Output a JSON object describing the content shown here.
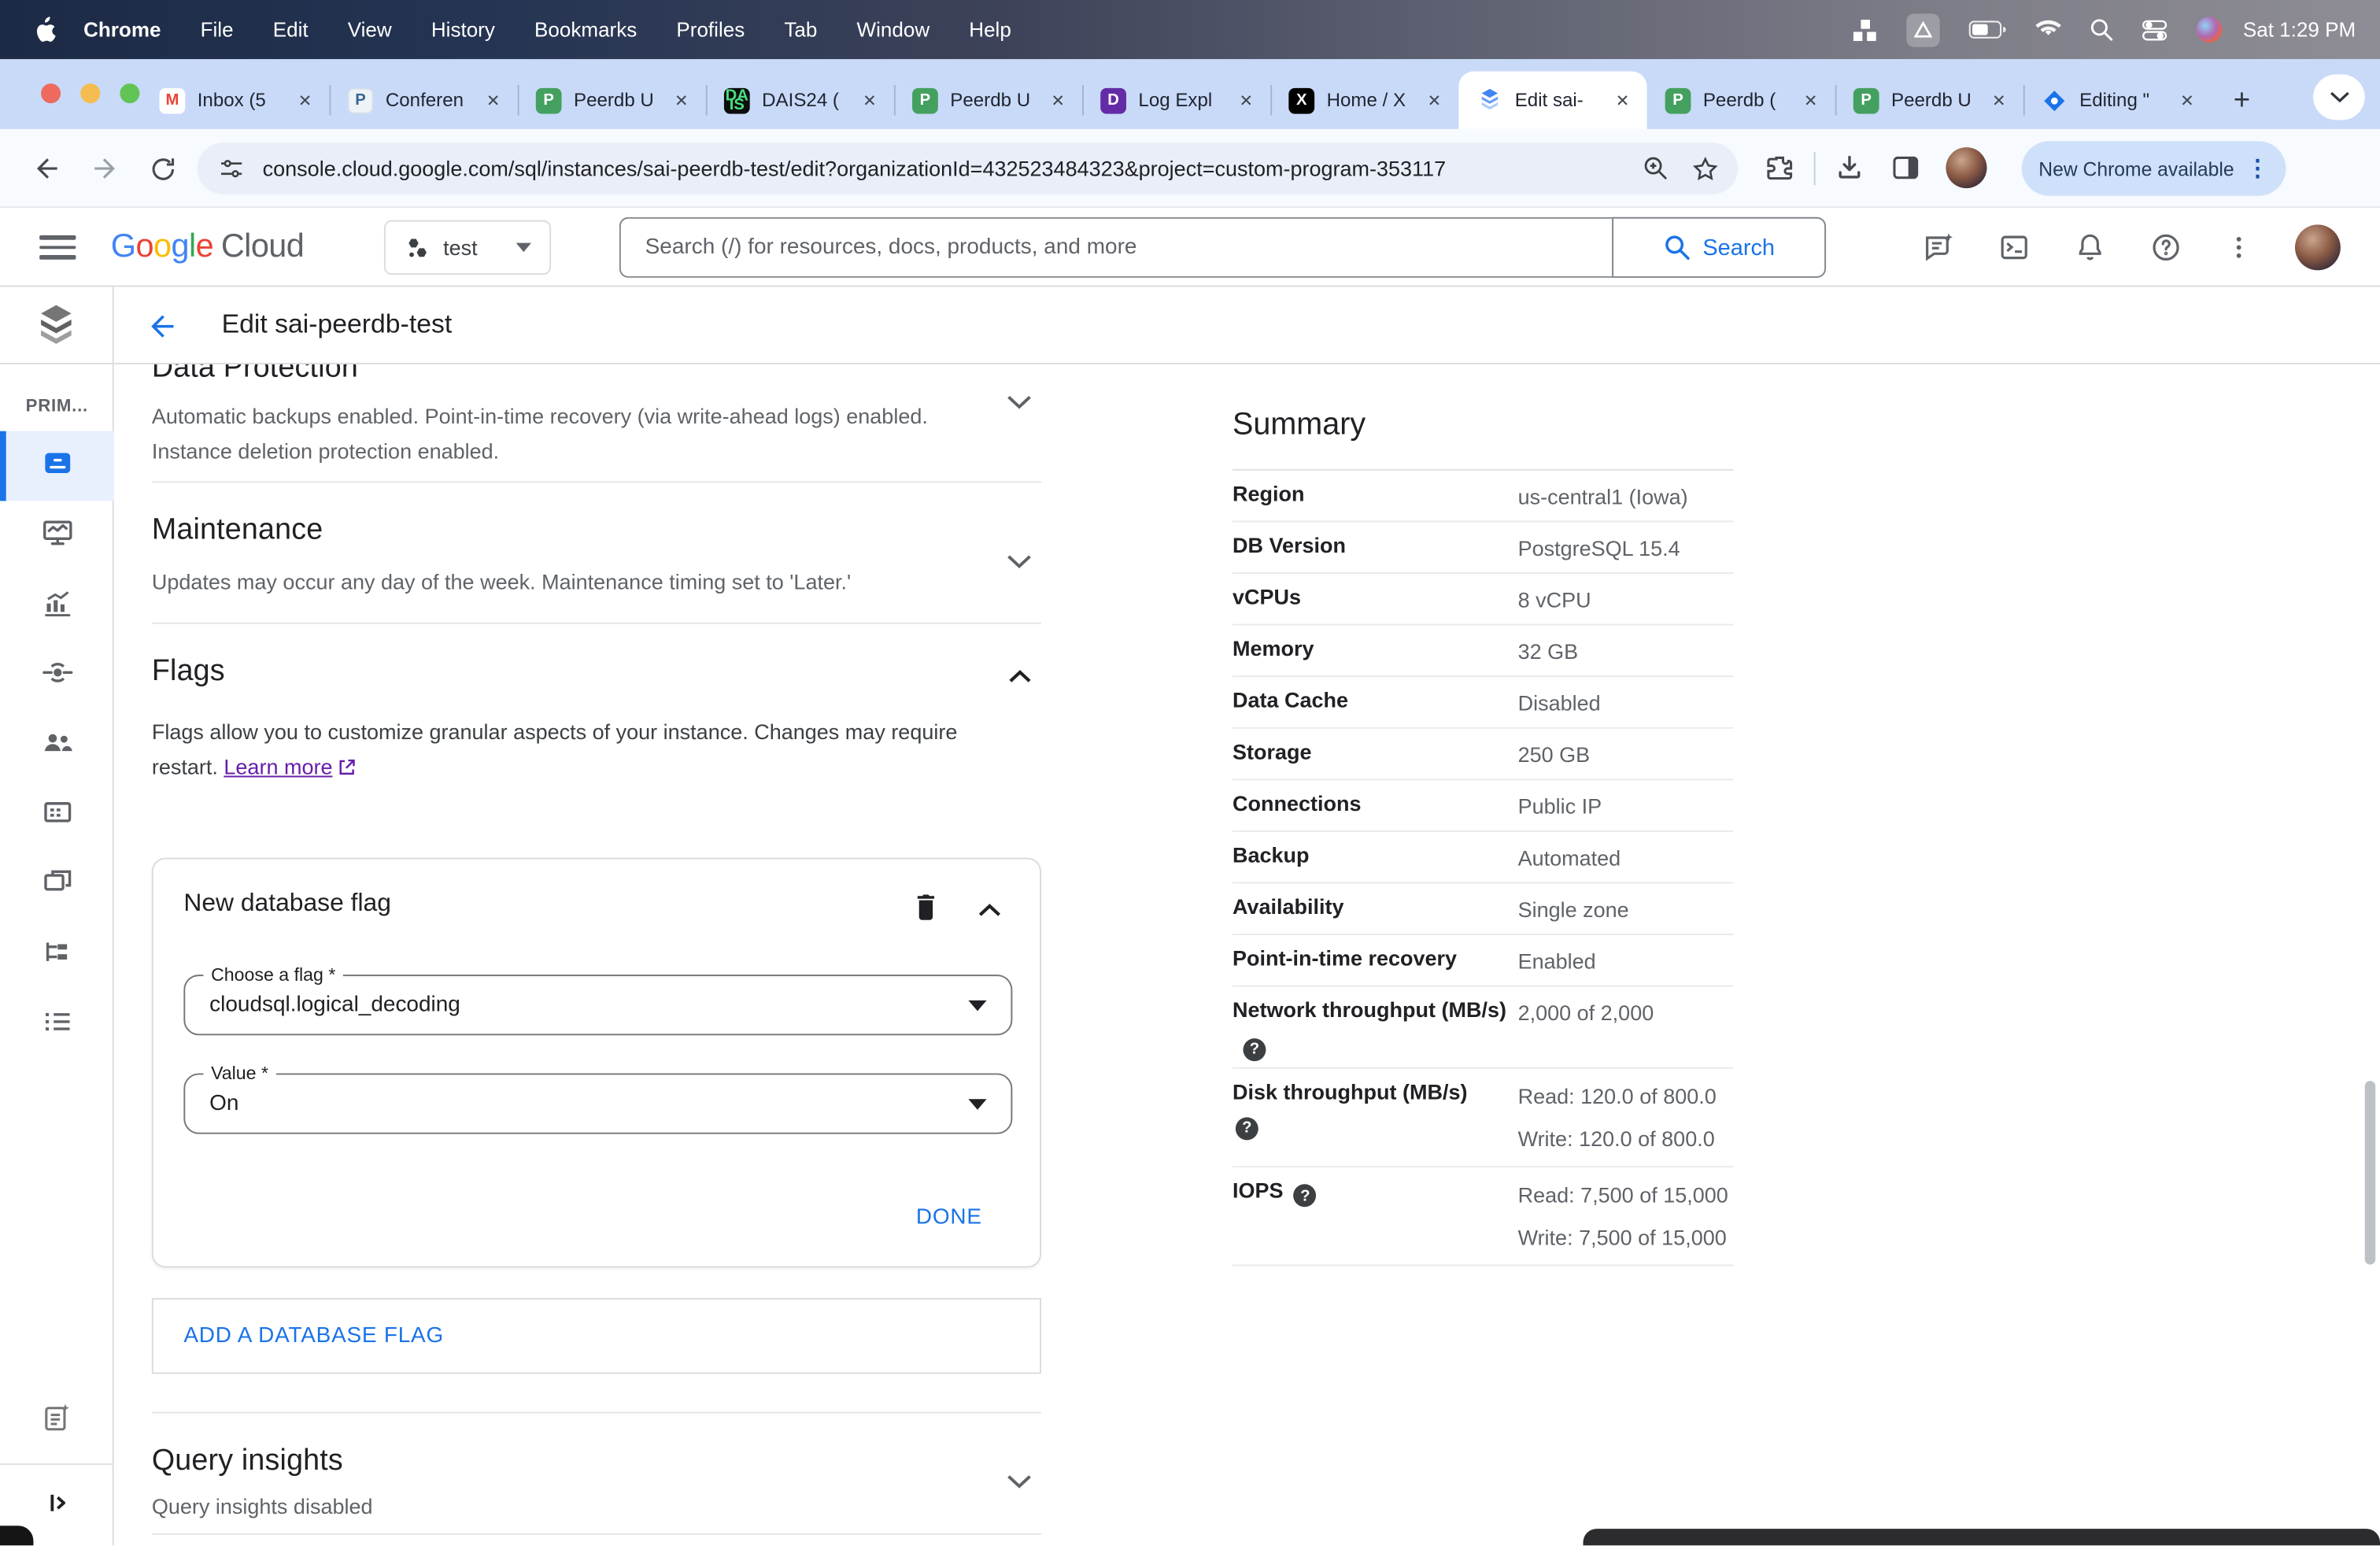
{
  "menu_bar": {
    "app_name": "Chrome",
    "items": [
      "File",
      "Edit",
      "View",
      "History",
      "Bookmarks",
      "Profiles",
      "Tab",
      "Window",
      "Help"
    ],
    "clock": "Sat 1:29 PM"
  },
  "browser": {
    "tabs": [
      {
        "label": "Inbox (5",
        "icon": "gmail"
      },
      {
        "label": "Conferen",
        "icon": "postgres"
      },
      {
        "label": "Peerdb U",
        "icon": "peerdb"
      },
      {
        "label": "DAIS24 (",
        "icon": "dais"
      },
      {
        "label": "Peerdb U",
        "icon": "peerdb"
      },
      {
        "label": "Log Expl",
        "icon": "datadog"
      },
      {
        "label": "Home / X",
        "icon": "x"
      },
      {
        "label": "Edit sai-",
        "icon": "cloudsql",
        "active": true
      },
      {
        "label": "Peerdb (",
        "icon": "peerdb"
      },
      {
        "label": "Peerdb U",
        "icon": "peerdb"
      },
      {
        "label": "Editing \"",
        "icon": "looker"
      }
    ],
    "new_tab_label": "+",
    "url": "console.cloud.google.com/sql/instances/sai-peerdb-test/edit?organizationId=432523484323&project=custom-program-353117",
    "update_pill": "New Chrome available"
  },
  "gcp_header": {
    "project_name": "test",
    "search_placeholder": "Search (/) for resources, docs, products, and more",
    "search_button": "Search"
  },
  "page": {
    "title": "Edit sai-peerdb-test",
    "rail_label": "PRIM..."
  },
  "sidebar": {
    "items": [
      {
        "icon": "overview",
        "active": true
      },
      {
        "icon": "system-insights"
      },
      {
        "icon": "query-insights"
      },
      {
        "icon": "connections"
      },
      {
        "icon": "users"
      },
      {
        "icon": "databases"
      },
      {
        "icon": "backups"
      },
      {
        "icon": "replicas"
      },
      {
        "icon": "operations"
      }
    ]
  },
  "sections": {
    "data_protection": {
      "title": "Data Protection",
      "body": "Automatic backups enabled. Point-in-time recovery (via write-ahead logs) enabled. Instance deletion protection enabled."
    },
    "maintenance": {
      "title": "Maintenance",
      "body": "Updates may occur any day of the week. Maintenance timing set to 'Later.'"
    },
    "flags": {
      "title": "Flags",
      "body": "Flags allow you to customize granular aspects of your instance. Changes may require restart.",
      "learn_more": "Learn more"
    },
    "flag_card": {
      "title": "New database flag",
      "flag_label": "Choose a flag *",
      "flag_value": "cloudsql.logical_decoding",
      "value_label": "Value *",
      "value_value": "On",
      "done_label": "DONE"
    },
    "add_flag_label": "ADD A DATABASE FLAG",
    "query_insights": {
      "title": "Query insights",
      "body": "Query insights disabled"
    }
  },
  "summary": {
    "title": "Summary",
    "rows": [
      {
        "label": "Region",
        "value": "us-central1 (Iowa)"
      },
      {
        "label": "DB Version",
        "value": "PostgreSQL 15.4"
      },
      {
        "label": "vCPUs",
        "value": "8 vCPU"
      },
      {
        "label": "Memory",
        "value": "32 GB"
      },
      {
        "label": "Data Cache",
        "value": "Disabled"
      },
      {
        "label": "Storage",
        "value": "250 GB"
      },
      {
        "label": "Connections",
        "value": "Public IP"
      },
      {
        "label": "Backup",
        "value": "Automated"
      },
      {
        "label": "Availability",
        "value": "Single zone"
      },
      {
        "label": "Point-in-time recovery",
        "value": "Enabled"
      },
      {
        "label": "Network throughput (MB/s)",
        "help": "inline",
        "value": "2,000 of 2,000"
      },
      {
        "label": "Disk throughput (MB/s)",
        "help": "below",
        "value": "Read: 120.0 of 800.0",
        "value2": "Write: 120.0 of 800.0"
      },
      {
        "label": "IOPS",
        "help": "inline",
        "value": "Read: 7,500 of 15,000",
        "value2": "Write: 7,500 of 15,000"
      }
    ]
  },
  "colors": {
    "accent_blue": "#1a73e8",
    "link_purple": "#681da8",
    "tabstrip_bg": "#c9daf8",
    "active_rail_bg": "#e8f0fe"
  }
}
